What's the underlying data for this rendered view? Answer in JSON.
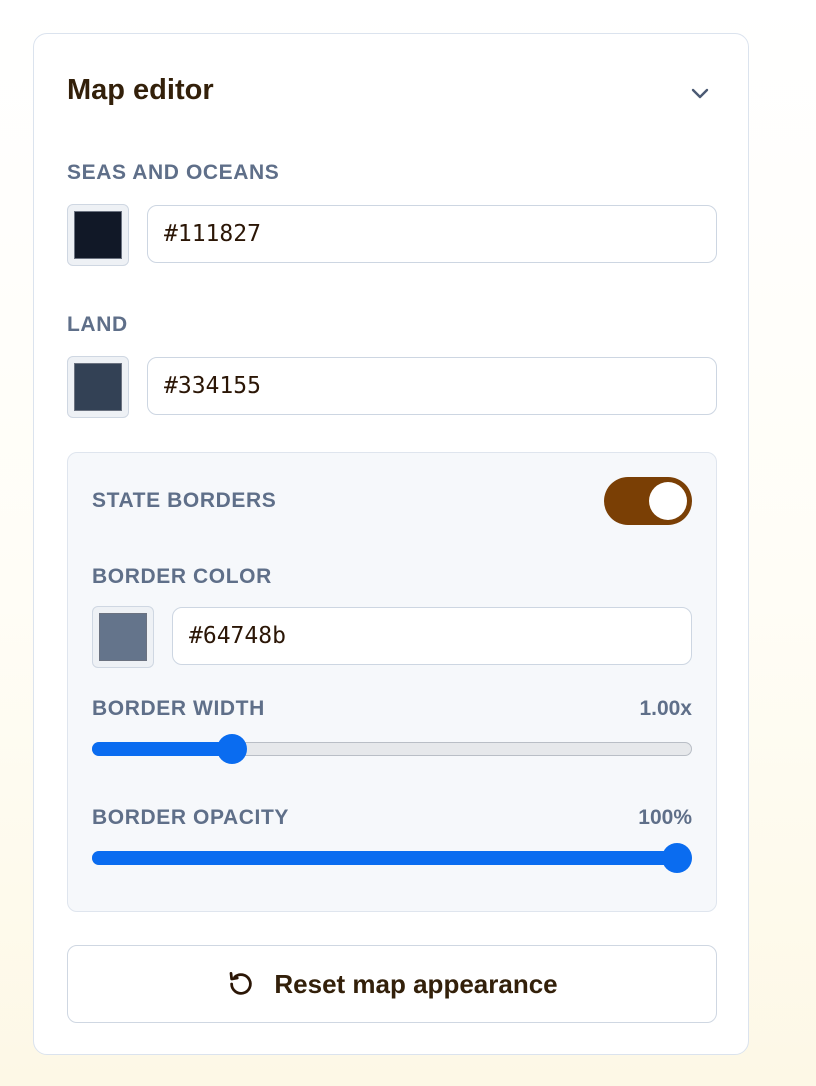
{
  "panel": {
    "title": "Map editor",
    "collapse_icon": "chevron-down-icon"
  },
  "seas": {
    "label": "SEAS AND OCEANS",
    "value": "#111827",
    "swatch_color": "#111827"
  },
  "land": {
    "label": "LAND",
    "value": "#334155",
    "swatch_color": "#334155"
  },
  "state_borders": {
    "label": "STATE BORDERS",
    "enabled": true,
    "toggle_color": "#7a3f05",
    "border_color": {
      "label": "BORDER COLOR",
      "value": "#64748b",
      "swatch_color": "#64748b"
    },
    "border_width": {
      "label": "BORDER WIDTH",
      "value_text": "1.00x",
      "fraction": 0.22
    },
    "border_opacity": {
      "label": "BORDER OPACITY",
      "value_text": "100%",
      "fraction": 1.0
    }
  },
  "reset": {
    "label": "Reset map appearance",
    "icon": "rotate-ccw-icon"
  },
  "colors": {
    "accent": "#0a6cf0",
    "label": "#5f6f89",
    "heading": "#33200a"
  }
}
